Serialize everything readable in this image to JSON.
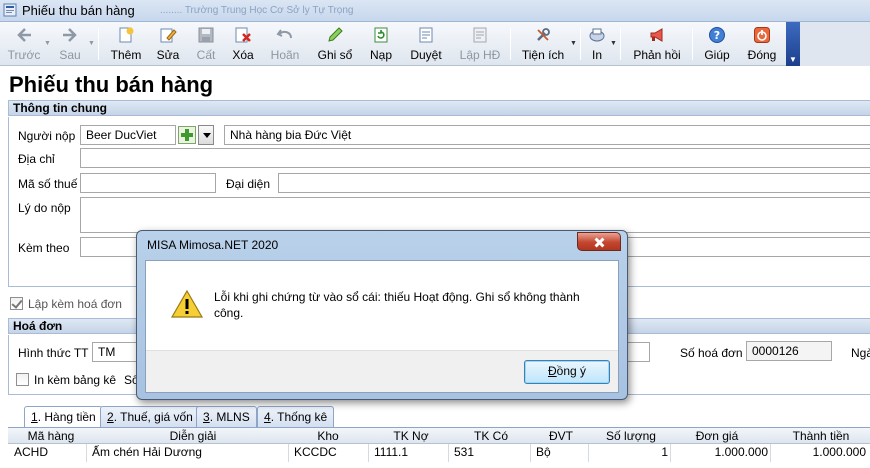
{
  "window": {
    "title": "Phiếu thu bán hàng",
    "ghost_text": "........ Trường Trung Học Cơ Sở ly Tự Trọng"
  },
  "toolbar": {
    "items": [
      {
        "label": "Trước",
        "icon": "arrow-left-icon",
        "enabled": false
      },
      {
        "label": "Sau",
        "icon": "arrow-right-icon",
        "enabled": false
      },
      {
        "label": "Thêm",
        "icon": "new-document-icon",
        "enabled": true
      },
      {
        "label": "Sửa",
        "icon": "edit-icon",
        "enabled": true
      },
      {
        "label": "Cất",
        "icon": "save-icon",
        "enabled": false
      },
      {
        "label": "Xóa",
        "icon": "delete-icon",
        "enabled": true
      },
      {
        "label": "Hoãn",
        "icon": "undo-icon",
        "enabled": false
      },
      {
        "label": "Ghi sổ",
        "icon": "pencil-icon",
        "enabled": true
      },
      {
        "label": "Nạp",
        "icon": "refresh-icon",
        "enabled": true
      },
      {
        "label": "Duyệt",
        "icon": "approve-icon",
        "enabled": true
      },
      {
        "label": "Lập HĐ",
        "icon": "invoice-icon",
        "enabled": false
      },
      {
        "label": "Tiện ích",
        "icon": "tools-icon",
        "enabled": true
      },
      {
        "label": "In",
        "icon": "print-icon",
        "enabled": true
      },
      {
        "label": "Phản hồi",
        "icon": "megaphone-icon",
        "enabled": true
      },
      {
        "label": "Giúp",
        "icon": "help-icon",
        "enabled": true
      },
      {
        "label": "Đóng",
        "icon": "power-icon",
        "enabled": true
      }
    ]
  },
  "page": {
    "title": "Phiếu thu bán hàng"
  },
  "general": {
    "section_title": "Thông tin chung",
    "payer_label": "Người nộp",
    "payer_code": "Beer DucViet",
    "payer_name": "Nhà hàng bia Đức Việt",
    "address_label": "Địa chỉ",
    "address_value": "",
    "tax_code_label": "Mã số thuế",
    "tax_code_value": "",
    "representative_label": "Đại diện",
    "representative_value": "",
    "reason_label": "Lý do nộp",
    "reason_value": "",
    "attachment_label": "Kèm theo",
    "attachment_value": ""
  },
  "invoice_check": {
    "label": "Lập kèm hoá đơn",
    "checked": true
  },
  "invoice": {
    "section_title": "Hoá đơn",
    "payment_method_label": "Hình thức TT",
    "payment_method_value": "TM",
    "invoice_no_label": "Số hoá đơn",
    "invoice_no_value": "0000126",
    "date_label_partial": "Ngà",
    "print_list_label": "In kèm bảng kê",
    "print_list_checked": false,
    "list_no_partial": "Số"
  },
  "tabs": [
    {
      "num": "1",
      "rest": ". Hàng tiền",
      "active": true
    },
    {
      "num": "2",
      "rest": ". Thuế, giá vốn",
      "active": false
    },
    {
      "num": "3",
      "rest": ". MLNS",
      "active": false
    },
    {
      "num": "4",
      "rest": ". Thống kê",
      "active": false
    }
  ],
  "grid": {
    "columns": [
      "Mã hàng",
      "Diễn giải",
      "Kho",
      "TK Nợ",
      "TK Có",
      "ĐVT",
      "Số lượng",
      "Đơn giá",
      "Thành tiền"
    ],
    "rows": [
      [
        "ACHD",
        "Ấm chén Hải Dương",
        "KCCDC",
        "1111.1",
        "531",
        "Bộ",
        "1",
        "1.000.000",
        "1.000.000"
      ]
    ]
  },
  "dialog": {
    "title": "MISA Mimosa.NET 2020",
    "message": "Lỗi khi ghi chứng từ vào sổ cái: thiếu Hoạt động. Ghi sổ không thành công.",
    "ok_underlined": "Đ",
    "ok_rest": "ồng ý"
  },
  "colors": {
    "accent_blue": "#1c3f8c",
    "section_bg": "#c5d4e8",
    "dialog_frame": "#a7c2e2"
  }
}
